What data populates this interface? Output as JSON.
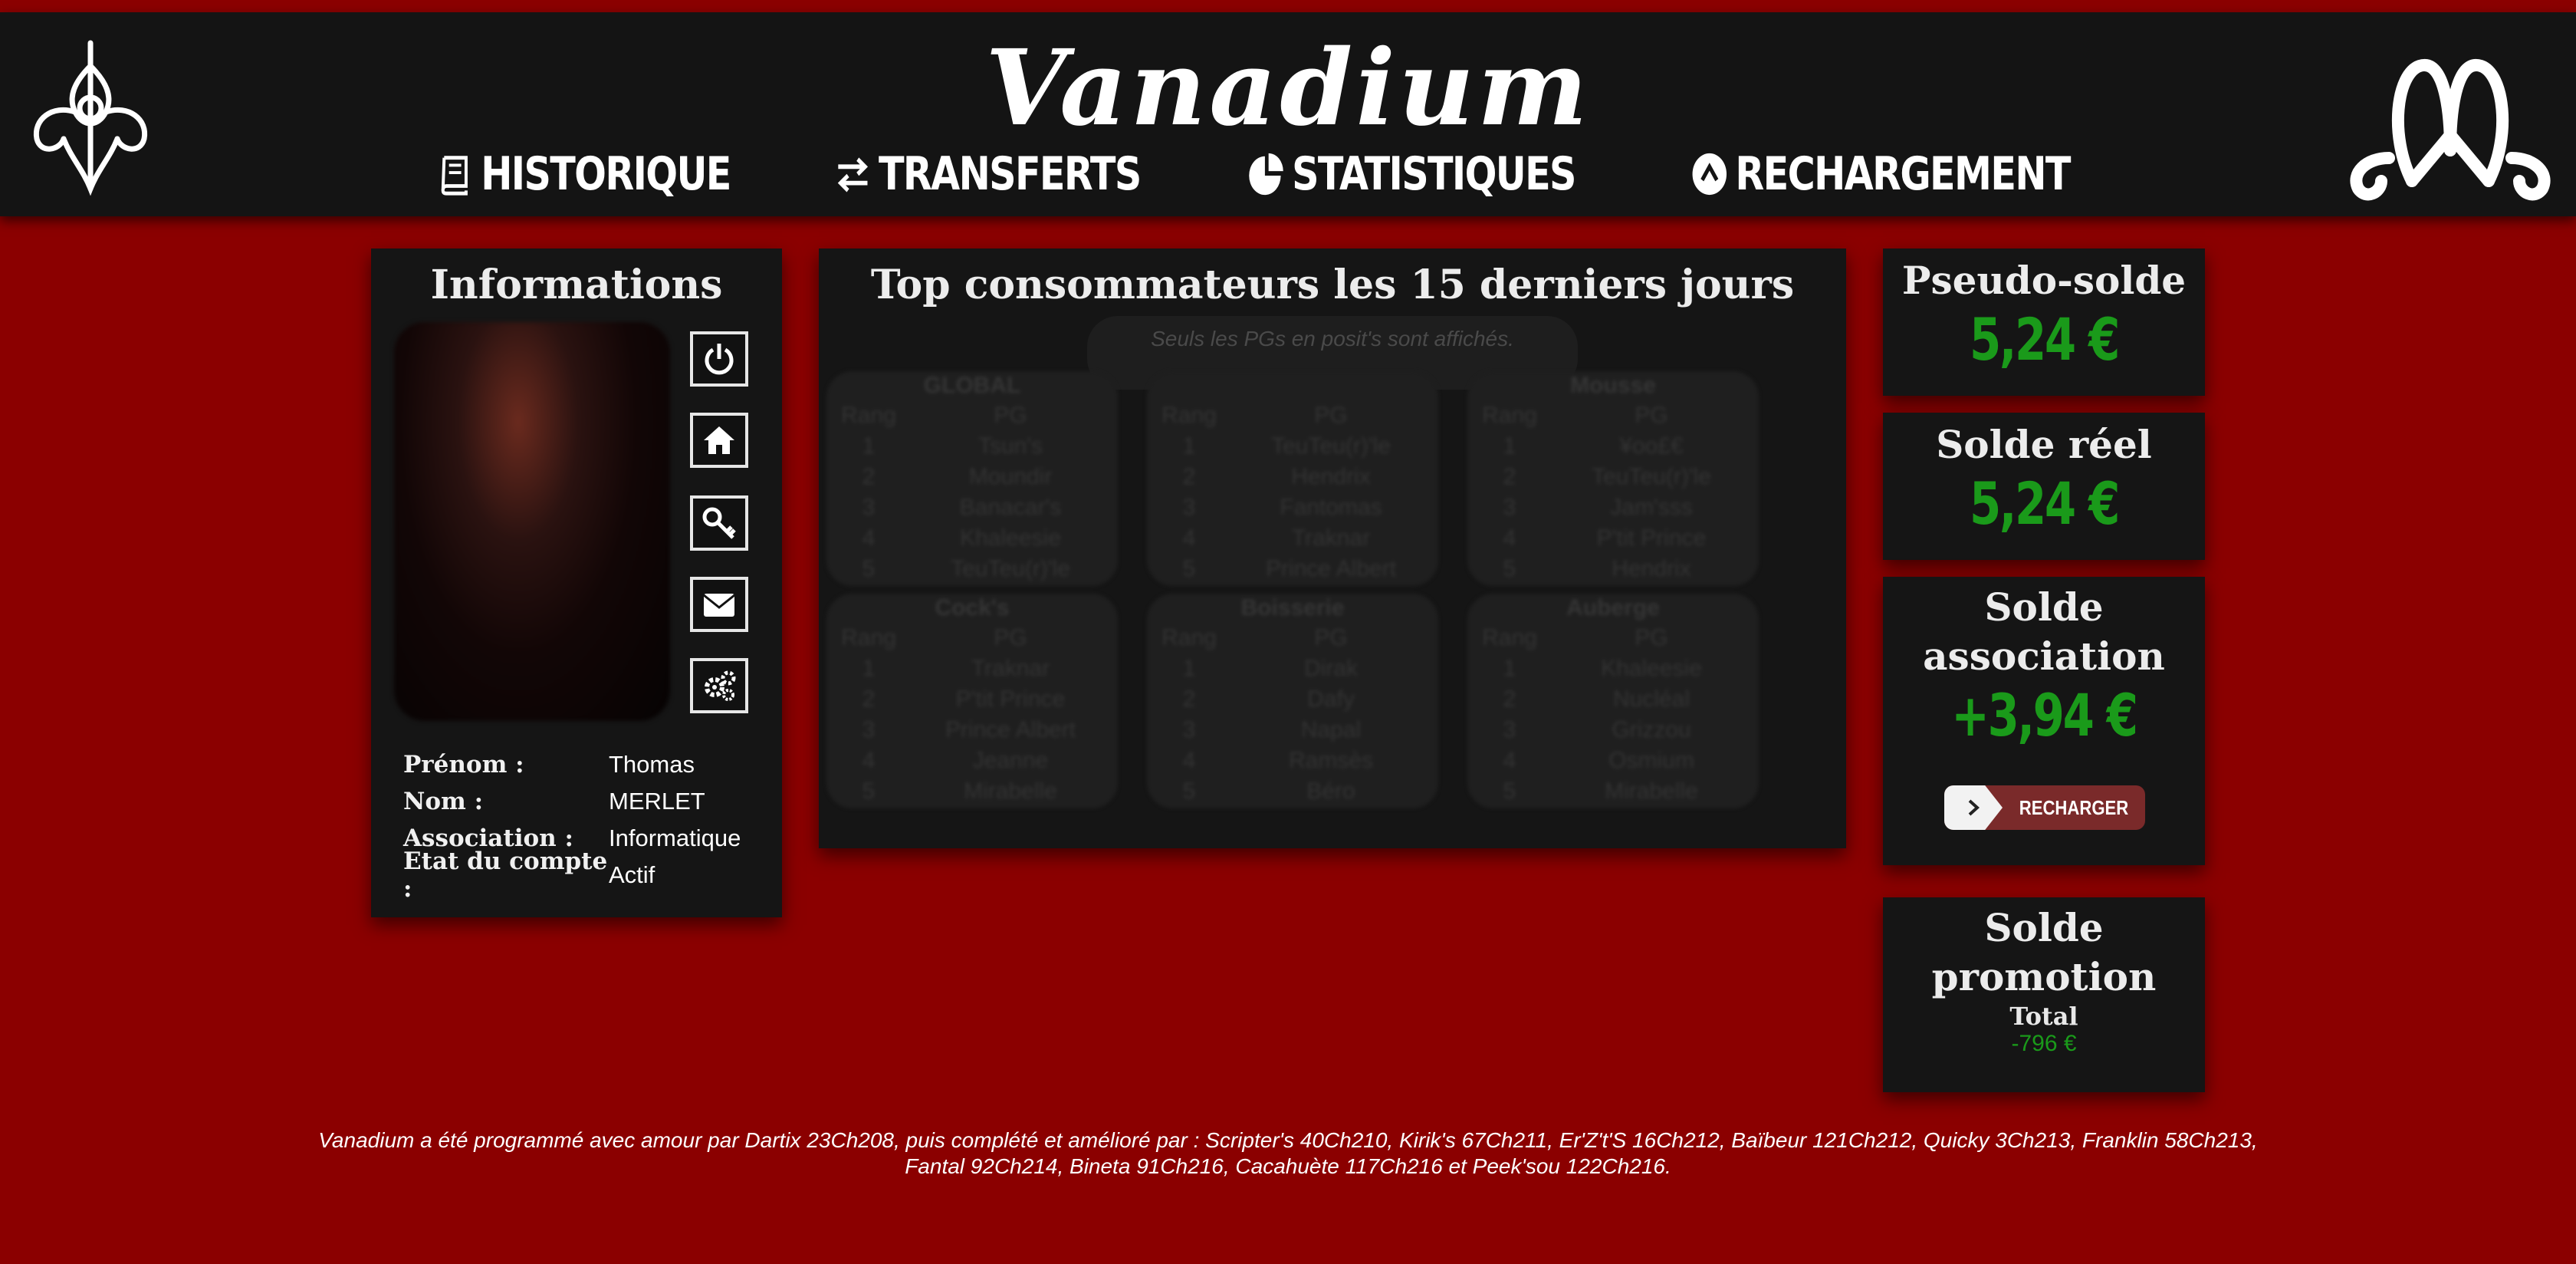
{
  "header": {
    "title": "Vanadium",
    "nav": [
      {
        "label": "HISTORIQUE",
        "icon": "book-icon"
      },
      {
        "label": "TRANSFERTS",
        "icon": "exchange-icon"
      },
      {
        "label": "STATISTIQUES",
        "icon": "pie-chart-icon"
      },
      {
        "label": "RECHARGEMENT",
        "icon": "arrow-up-circle-icon"
      }
    ]
  },
  "info": {
    "title": "Informations",
    "fields": [
      {
        "label": "Prénom :",
        "value": "Thomas"
      },
      {
        "label": "Nom :",
        "value": "MERLET"
      },
      {
        "label": "Association :",
        "value": "Informatique"
      },
      {
        "label": "Etat du compte :",
        "value": "Actif"
      }
    ],
    "buttons": [
      "power-icon",
      "home-icon",
      "key-icon",
      "envelope-icon",
      "gears-icon"
    ]
  },
  "top": {
    "title": "Top consommateurs les 15 derniers jours",
    "note": "Seuls les PGs en posit's sont affichés.",
    "col_rank": "Rang",
    "col_pg": "PG",
    "blocks": [
      {
        "name": "GLOBAL",
        "rows": [
          [
            "1",
            "Tsun's"
          ],
          [
            "2",
            "Moundir"
          ],
          [
            "3",
            "Banacar's"
          ],
          [
            "4",
            "Khaleesie"
          ],
          [
            "5",
            "TeuTeu(r)'le"
          ]
        ]
      },
      {
        "name": "",
        "rows": [
          [
            "1",
            "TeuTeu(r)'le"
          ],
          [
            "2",
            "Hendrix"
          ],
          [
            "3",
            "Fantomas"
          ],
          [
            "4",
            "Traknar"
          ],
          [
            "5",
            "Prince Albert"
          ]
        ]
      },
      {
        "name": "Mousse",
        "rows": [
          [
            "1",
            "¥oo£€"
          ],
          [
            "2",
            "TeuTeu(r)'le"
          ],
          [
            "3",
            "Jam'sss"
          ],
          [
            "4",
            "P'tit Prince"
          ],
          [
            "5",
            "Hendrix"
          ]
        ]
      },
      {
        "name": "Cock's",
        "rows": [
          [
            "1",
            "Traknar"
          ],
          [
            "2",
            "P'tit Prince"
          ],
          [
            "3",
            "Prince Albert"
          ],
          [
            "4",
            "Jeanne"
          ],
          [
            "5",
            "Mirabelle"
          ]
        ]
      },
      {
        "name": "Boisserie",
        "rows": [
          [
            "1",
            "Dirak"
          ],
          [
            "2",
            "Dafy"
          ],
          [
            "3",
            "Napal"
          ],
          [
            "4",
            "Ramsès"
          ],
          [
            "5",
            "Béro"
          ]
        ]
      },
      {
        "name": "Auberge",
        "rows": [
          [
            "1",
            "Khaleesie"
          ],
          [
            "2",
            "Nucléal"
          ],
          [
            "3",
            "Grizzou"
          ],
          [
            "4",
            "Osmium"
          ],
          [
            "5",
            "Mirabelle"
          ]
        ]
      }
    ]
  },
  "balances": {
    "pseudo_title": "Pseudo-solde",
    "pseudo_value": "5,24 €",
    "real_title": "Solde réel",
    "real_value": "5,24 €",
    "assoc_title_1": "Solde",
    "assoc_title_2": "association",
    "assoc_value": "+3,94 €",
    "recharge_label": "RECHARGER",
    "promo_title_1": "Solde",
    "promo_title_2": "promotion",
    "promo_total_label": "Total",
    "promo_total_value": "-796 €"
  },
  "footer": {
    "text": "Vanadium a été programmé avec amour par Dartix 23Ch208, puis complété et amélioré par : Scripter's 40Ch210, Kirik's 67Ch211, Er'Z't'S 16Ch212, Baïbeur 121Ch212, Quicky 3Ch213, Franklin 58Ch213, Fantal 92Ch214, Bineta 91Ch216, Cacahuète 117Ch216 et Peek'sou 122Ch216."
  },
  "colors": {
    "background": "#8b0000",
    "panel": "#151515",
    "header": "#141414",
    "amount_green": "#1a9a1a",
    "recharge_button": "#7a2a2a"
  }
}
